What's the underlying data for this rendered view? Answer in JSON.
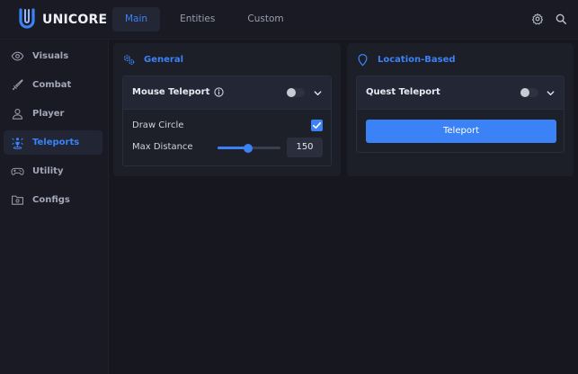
{
  "app": {
    "brand": "UNICORE",
    "accent": "#3b82f6"
  },
  "header": {
    "tabs": [
      {
        "label": "Main",
        "active": true
      },
      {
        "label": "Entities",
        "active": false
      },
      {
        "label": "Custom",
        "active": false
      }
    ],
    "icons": [
      "gear-icon",
      "search-icon"
    ]
  },
  "sidebar": {
    "items": [
      {
        "label": "Visuals",
        "icon": "eye-icon",
        "active": false
      },
      {
        "label": "Combat",
        "icon": "sword-icon",
        "active": false
      },
      {
        "label": "Player",
        "icon": "user-icon",
        "active": false
      },
      {
        "label": "Teleports",
        "icon": "teleport-icon",
        "active": true
      },
      {
        "label": "Utility",
        "icon": "gamepad-icon",
        "active": false
      },
      {
        "label": "Configs",
        "icon": "folder-gear-icon",
        "active": false
      }
    ]
  },
  "panels": {
    "general": {
      "title": "General",
      "mouse_teleport": {
        "title": "Mouse Teleport",
        "enabled": false,
        "draw_circle": {
          "label": "Draw Circle",
          "checked": true
        },
        "max_distance": {
          "label": "Max Distance",
          "value": "150",
          "fraction": 0.48
        }
      }
    },
    "location_based": {
      "title": "Location-Based",
      "quest_teleport": {
        "title": "Quest Teleport",
        "enabled": false,
        "button_label": "Teleport"
      }
    }
  }
}
